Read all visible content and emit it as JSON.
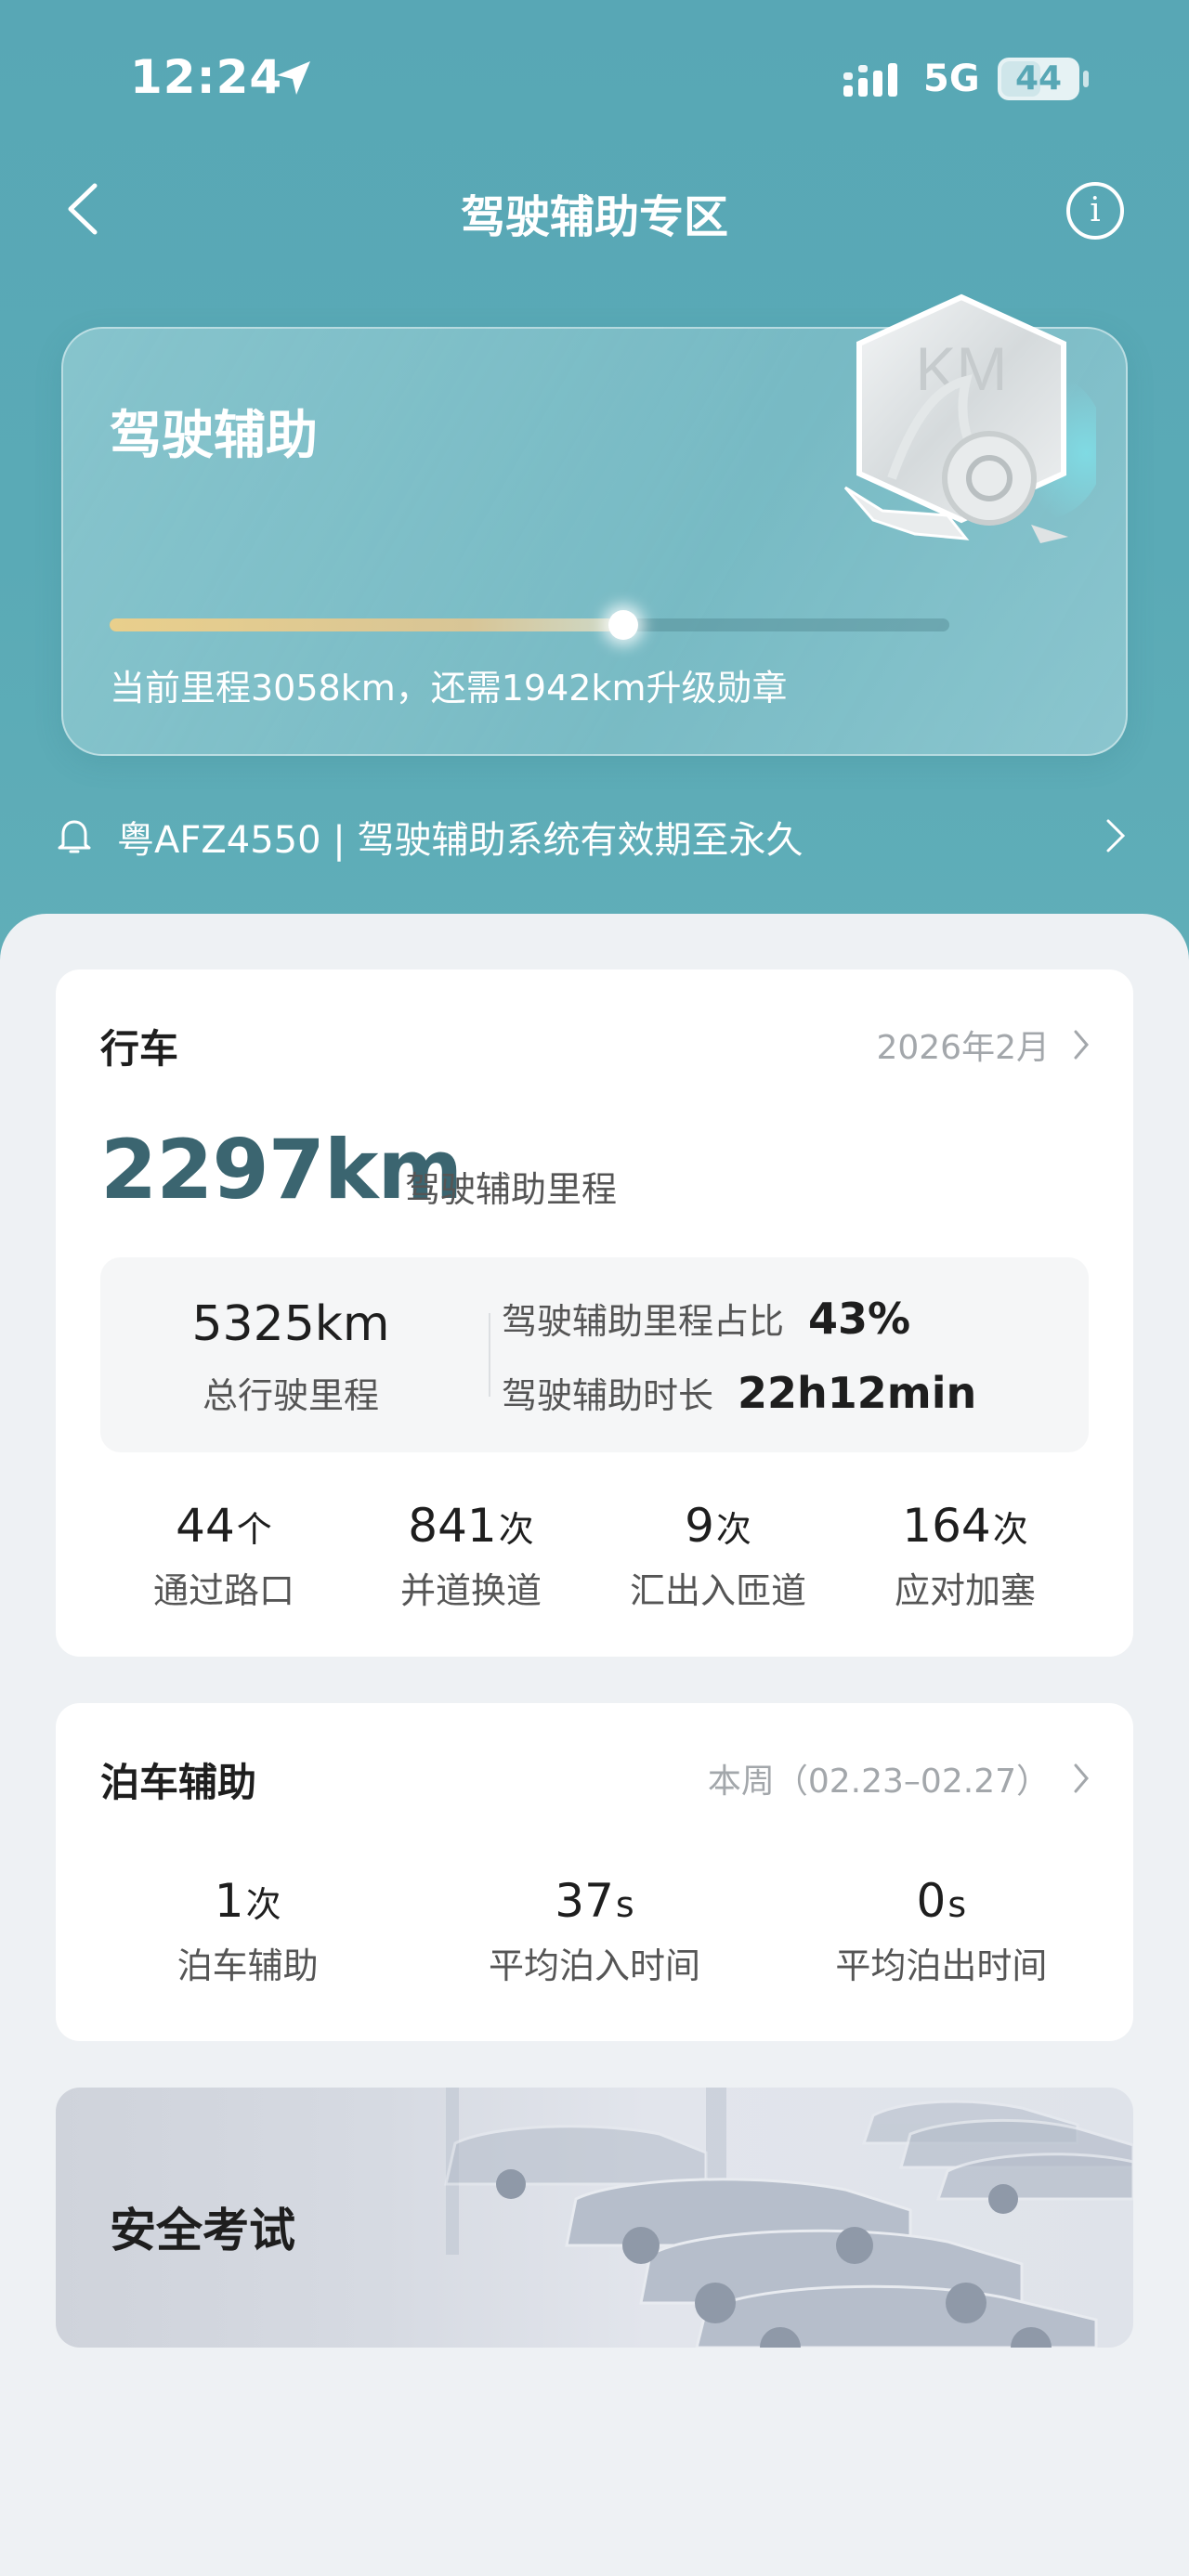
{
  "status_bar": {
    "time": "12:24",
    "network": "5G",
    "battery": "44"
  },
  "nav": {
    "title": "驾驶辅助专区"
  },
  "hero": {
    "title": "驾驶辅助",
    "badge_text": "KM",
    "progress_fraction": 0.6116,
    "progress_text": "当前里程3058km，还需1942km升级勋章"
  },
  "notice": {
    "text": "粤AFZ4550 | 驾驶辅助系统有效期至永久"
  },
  "driving": {
    "title": "行车",
    "period": "2026年2月",
    "assist_km": "2297km",
    "assist_km_label": "驾驶辅助里程",
    "total_km": "5325km",
    "total_km_label": "总行驶里程",
    "ratio_label": "驾驶辅助里程占比",
    "ratio_value": "43%",
    "duration_label": "驾驶辅助时长",
    "duration_value": "22h12min",
    "stats": [
      {
        "value": "44",
        "unit": "个",
        "label": "通过路口"
      },
      {
        "value": "841",
        "unit": "次",
        "label": "并道换道"
      },
      {
        "value": "9",
        "unit": "次",
        "label": "汇出入匝道"
      },
      {
        "value": "164",
        "unit": "次",
        "label": "应对加塞"
      }
    ]
  },
  "parking": {
    "title": "泊车辅助",
    "period": "本周（02.23–02.27）",
    "stats": [
      {
        "value": "1",
        "unit": "次",
        "label": "泊车辅助"
      },
      {
        "value": "37",
        "unit": "s",
        "label": "平均泊入时间"
      },
      {
        "value": "0",
        "unit": "s",
        "label": "平均泊出时间"
      }
    ]
  },
  "exam": {
    "label": "安全考试"
  },
  "colors": {
    "header_teal": "#58a7b5",
    "accent_km": "#3b6570",
    "progress_gold": "#e9cf8c"
  },
  "icons": [
    "location-arrow-icon",
    "signal-icon",
    "battery-icon",
    "back-chevron-icon",
    "info-icon",
    "bell-icon",
    "chevron-right-icon",
    "km-medal-icon"
  ]
}
